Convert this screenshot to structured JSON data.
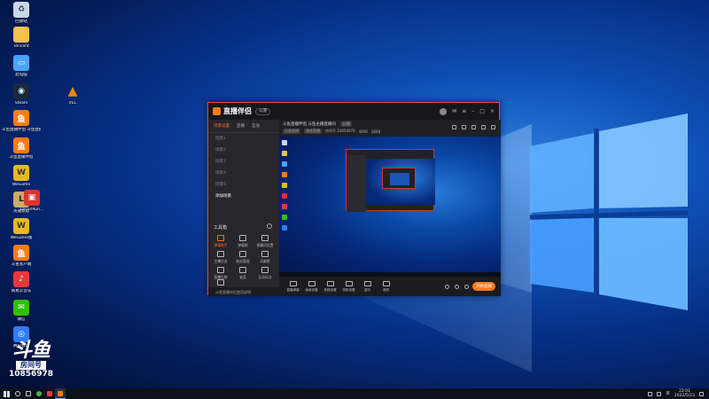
{
  "desktop_icons": [
    {
      "label": "回收站",
      "icon": "recycle-bin-icon",
      "color": "#c9d7e8"
    },
    {
      "label": "Tencent",
      "icon": "folder-icon",
      "color": "#f2c14e"
    },
    {
      "label": "此电脑",
      "icon": "computer-icon",
      "color": "#4aa3ff"
    },
    {
      "label": "Steam",
      "icon": "steam-icon",
      "color": "#1b2838"
    },
    {
      "label": "斗鱼直播伴侣\n斗鱼直播伴侣",
      "icon": "douyu-icon",
      "color": "#ff7a1a"
    },
    {
      "label": "斗鱼直播伴侣",
      "icon": "douyu-icon",
      "color": "#ff7a1a"
    },
    {
      "label": "WeGame",
      "icon": "wegame-icon",
      "color": "#e8b923"
    },
    {
      "label": "英雄联盟",
      "icon": "lol-icon",
      "color": "#c8aa6e"
    },
    {
      "label": "WeGame版",
      "icon": "wegame-icon",
      "color": "#e8b923"
    },
    {
      "label": "斗鱼客户端",
      "icon": "douyu-client-icon",
      "color": "#ff7a1a"
    },
    {
      "label": "网易云音乐",
      "icon": "netease-music-icon",
      "color": "#e4393c"
    },
    {
      "label": "微信",
      "icon": "wechat-icon",
      "color": "#2dc100"
    },
    {
      "label": "腾讯会议",
      "icon": "tencent-meeting-icon",
      "color": "#2e7cf6"
    },
    {
      "label": "VLC",
      "icon": "vlc-icon",
      "color": "#f08c00"
    },
    {
      "label": "LeyunRun...",
      "icon": "app-icon",
      "color": "#d8352e"
    }
  ],
  "watermark": {
    "logo": "斗鱼",
    "room_label": "房间号",
    "room_number": "10856978"
  },
  "app": {
    "title": "直播伴侣",
    "badge": "公测",
    "sidebar_tabs": [
      "场景设置",
      "直播",
      "互动"
    ],
    "scenes": [
      "场景1",
      "场景2",
      "场景3",
      "场景4",
      "场景5",
      "添加场景"
    ],
    "tools_title": "工具箱",
    "tools": [
      "弹幕助手",
      "弹幕姬",
      "直播间设置",
      "主播任务",
      "粉丝管理",
      "贡献榜",
      "直播礼物",
      "抽奖",
      "互动玩法",
      "更多"
    ],
    "footer": "斗鱼直播伴侣使用说明",
    "header_title": "斗鱼直播伴侣 斗鱼主播直播间",
    "header_pill": "公测",
    "meta": [
      "分类选择",
      "游戏直播",
      "房间号 10856978",
      "4898",
      "3848"
    ],
    "bottom_buttons": [
      "直播弹幕",
      "画面设置",
      "音频设置",
      "录制设置",
      "监听",
      "美颜"
    ],
    "live_button": "开始直播"
  },
  "taskbar": {
    "time": "22:01",
    "date": "2022/5/23",
    "lang": "英"
  }
}
